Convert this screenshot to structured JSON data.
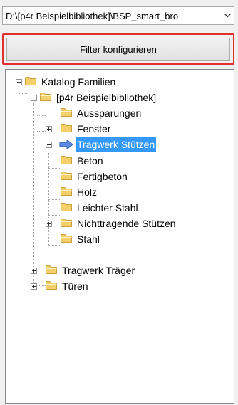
{
  "path_combo": {
    "value": "D:\\[p4r Beispielbibliothek]\\BSP_smart_bro"
  },
  "filter_button": {
    "label": "Filter konfigurieren"
  },
  "tree": {
    "root": "Katalog Familien",
    "library": "[p4r Beispielbibliothek]",
    "items": [
      "Aussparungen",
      "Fenster",
      "Tragwerk Stützen",
      "Tragwerk Träger",
      "Türen"
    ],
    "children": [
      "Beton",
      "Fertigbeton",
      "Holz",
      "Leichter Stahl",
      "Nichttragende Stützen",
      "Stahl"
    ]
  },
  "colors": {
    "selection": "#3399ff",
    "highlight_border": "#e03030",
    "folder": "#f5cf69"
  }
}
